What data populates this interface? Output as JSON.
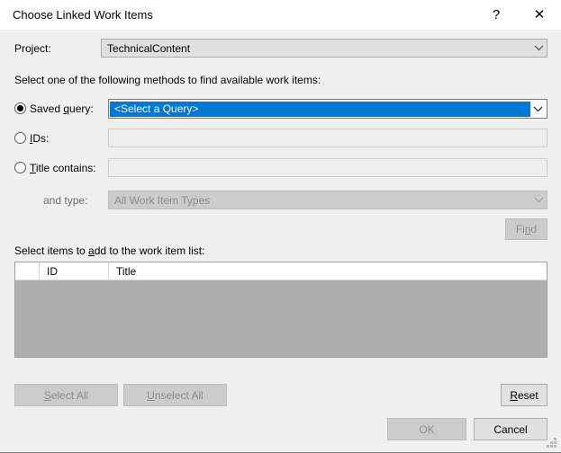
{
  "window": {
    "title": "Choose Linked Work Items",
    "help_label": "?",
    "close_label": "✕"
  },
  "project": {
    "label": "Project:",
    "value": "TechnicalContent",
    "chevron": "⌄"
  },
  "instruction": "Select one of the following methods to find available work items:",
  "methods": {
    "saved_query": {
      "label_before": "Saved ",
      "label_accel": "q",
      "label_after": "uery:",
      "value": "<Select a Query>",
      "chevron": "⌄",
      "selected": true
    },
    "ids": {
      "label_before": "",
      "label_accel": "I",
      "label_after": "Ds:",
      "value": "",
      "placeholder": "",
      "selected": false
    },
    "title_contains": {
      "label_before": "",
      "label_accel": "T",
      "label_after": "itle contains:",
      "value": "",
      "placeholder": "",
      "selected": false
    },
    "and_type": {
      "label": "and type:",
      "value": "All Work Item Types",
      "chevron": "⌄"
    }
  },
  "find_button": {
    "label_before": "Fi",
    "label_accel": "n",
    "label_after": "d"
  },
  "list": {
    "caption_before": "Select items to ",
    "caption_accel": "a",
    "caption_after": "dd to the work item list:",
    "columns": [
      "",
      "ID",
      "Title"
    ],
    "rows": []
  },
  "buttons": {
    "select_all": {
      "label_before": "",
      "label_accel": "S",
      "label_after": "elect All"
    },
    "unselect_all": {
      "label_before": "",
      "label_accel": "U",
      "label_after": "nselect All"
    },
    "reset": {
      "label_before": "",
      "label_accel": "R",
      "label_after": "eset"
    },
    "ok": {
      "label": "OK"
    },
    "cancel": {
      "label": "Cancel"
    }
  },
  "colors": {
    "dialog_bg": "#f0f0f0",
    "titlebar_bg": "#ffffff",
    "selection_blue": "#0078d7",
    "disabled_grey": "#cccccc",
    "list_body_grey": "#adadad"
  }
}
